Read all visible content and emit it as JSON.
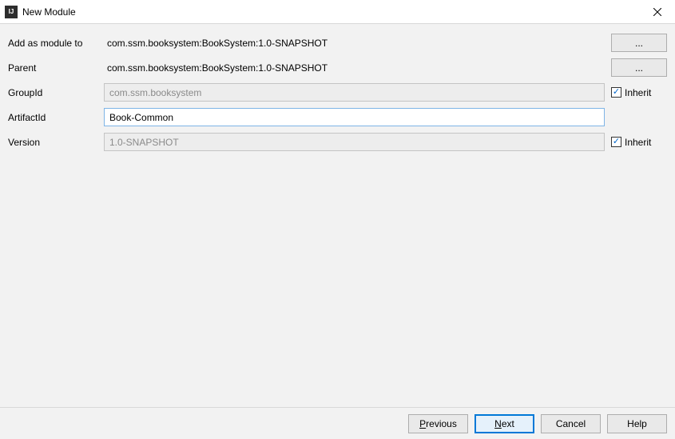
{
  "window": {
    "title": "New Module",
    "app_icon_text": "IJ"
  },
  "form": {
    "add_as_module_to": {
      "label": "Add as module to",
      "value": "com.ssm.booksystem:BookSystem:1.0-SNAPSHOT",
      "browse": "..."
    },
    "parent": {
      "label": "Parent",
      "value": "com.ssm.booksystem:BookSystem:1.0-SNAPSHOT",
      "browse": "..."
    },
    "group_id": {
      "label": "GroupId",
      "value": "com.ssm.booksystem",
      "inherit_label": "Inherit",
      "inherit_checked": true
    },
    "artifact_id": {
      "label": "ArtifactId",
      "value": "Book-Common"
    },
    "version": {
      "label": "Version",
      "value": "1.0-SNAPSHOT",
      "inherit_label": "Inherit",
      "inherit_checked": true
    }
  },
  "footer": {
    "previous": "Previous",
    "next": "Next",
    "cancel": "Cancel",
    "help": "Help"
  }
}
